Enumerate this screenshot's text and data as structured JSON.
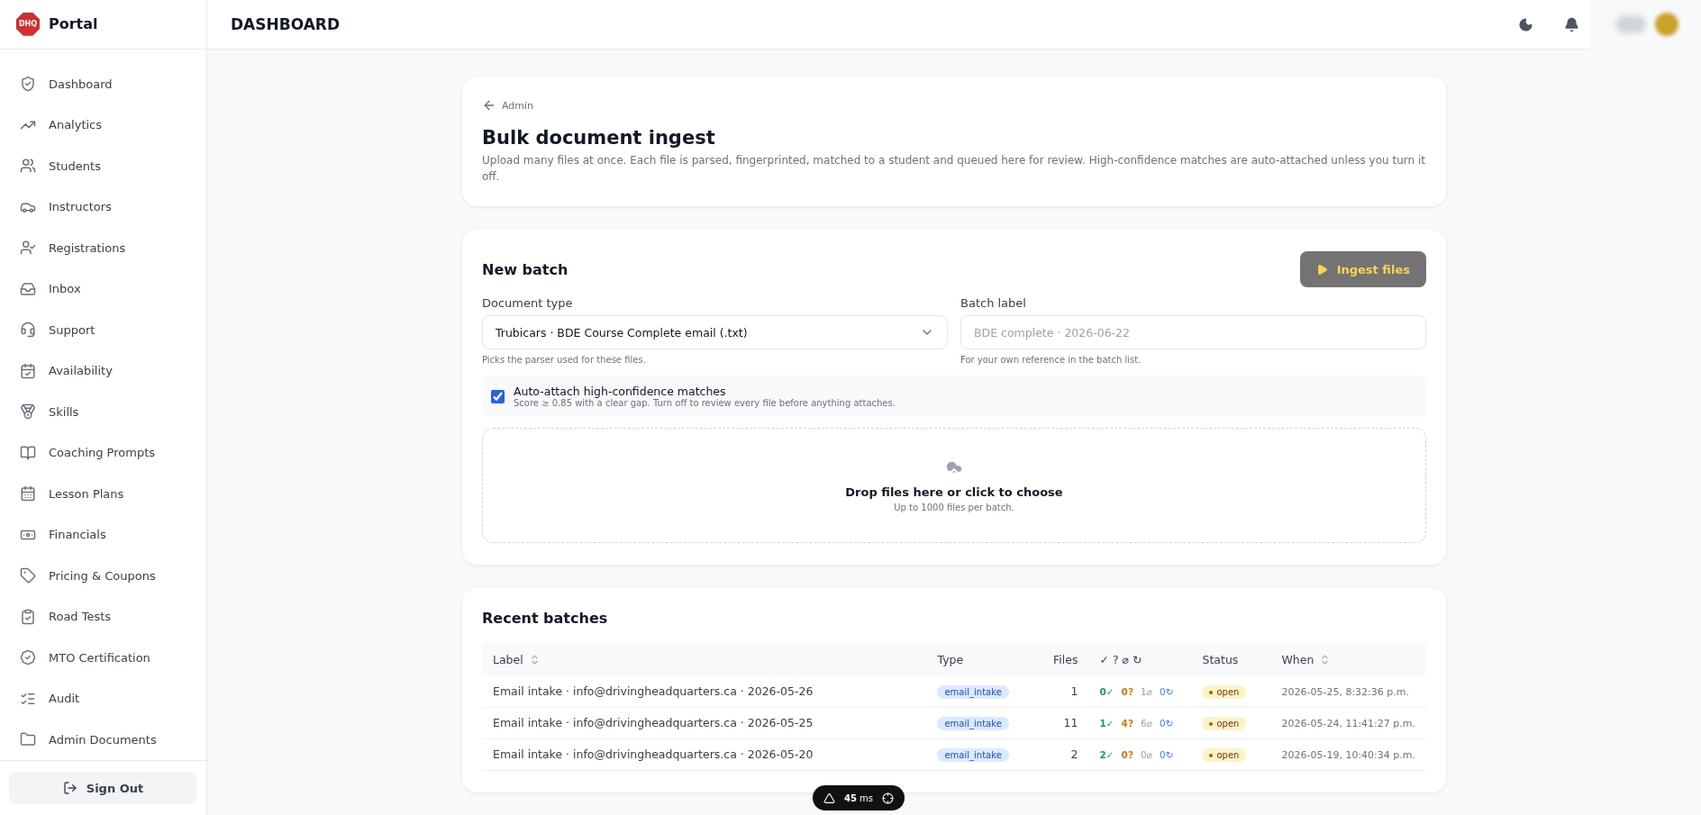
{
  "brand": {
    "logo": "DHQ",
    "name": "Portal"
  },
  "header": {
    "title": "DASHBOARD"
  },
  "sidebar": {
    "items": [
      {
        "label": "Dashboard"
      },
      {
        "label": "Analytics"
      },
      {
        "label": "Students"
      },
      {
        "label": "Instructors"
      },
      {
        "label": "Registrations"
      },
      {
        "label": "Inbox"
      },
      {
        "label": "Support"
      },
      {
        "label": "Availability"
      },
      {
        "label": "Skills"
      },
      {
        "label": "Coaching Prompts"
      },
      {
        "label": "Lesson Plans"
      },
      {
        "label": "Financials"
      },
      {
        "label": "Pricing & Coupons"
      },
      {
        "label": "Road Tests"
      },
      {
        "label": "MTO Certification"
      },
      {
        "label": "Audit"
      },
      {
        "label": "Admin Documents"
      }
    ],
    "sign_out": "Sign Out"
  },
  "intro": {
    "back": "Admin",
    "title": "Bulk document ingest",
    "description": "Upload many files at once. Each file is parsed, fingerprinted, matched to a student and queued here for review. High-confidence matches are auto-attached unless you turn it off."
  },
  "new_batch": {
    "title": "New batch",
    "button": "Ingest files",
    "document_type": {
      "label": "Document type",
      "value": "Trubicars · BDE Course Complete email (.txt)",
      "hint": "Picks the parser used for these files."
    },
    "batch_label": {
      "label": "Batch label",
      "placeholder": "BDE complete · 2026-06-22",
      "hint": "For your own reference in the batch list."
    },
    "auto_attach": {
      "label": "Auto-attach high-confidence matches",
      "hint": "Score ≥ 0.85 with a clear gap. Turn off to review every file before anything attaches.",
      "checked": true
    },
    "dropzone": {
      "title": "Drop files here or click to choose",
      "hint": "Up to 1000 files per batch."
    }
  },
  "recent": {
    "title": "Recent batches",
    "columns": [
      {
        "label": "Label",
        "sortable": true
      },
      {
        "label": "Type",
        "sortable": false
      },
      {
        "label": "Files",
        "sortable": false
      },
      {
        "label": "✓ ? ⌀ ↻",
        "sortable": false
      },
      {
        "label": "Status",
        "sortable": false
      },
      {
        "label": "When",
        "sortable": true
      }
    ],
    "rows": [
      {
        "label": "Email intake · info@drivingheadquarters.ca · 2026-05-26",
        "type": "email_intake",
        "files": "1",
        "stats": [
          {
            "kind": "matched",
            "text": "0✓"
          },
          {
            "kind": "unsure",
            "text": "0?"
          },
          {
            "kind": "skipped",
            "text": "1⌀"
          },
          {
            "kind": "retry",
            "text": "0↻"
          }
        ],
        "status": "open",
        "when": "2026-05-25, 8:32:36 p.m."
      },
      {
        "label": "Email intake · info@drivingheadquarters.ca · 2026-05-25",
        "type": "email_intake",
        "files": "11",
        "stats": [
          {
            "kind": "matched",
            "text": "1✓"
          },
          {
            "kind": "unsure",
            "text": "4?"
          },
          {
            "kind": "skipped",
            "text": "6⌀"
          },
          {
            "kind": "retry",
            "text": "0↻"
          }
        ],
        "status": "open",
        "when": "2026-05-24, 11:41:27 p.m."
      },
      {
        "label": "Email intake · info@drivingheadquarters.ca · 2026-05-20",
        "type": "email_intake",
        "files": "2",
        "stats": [
          {
            "kind": "matched",
            "text": "2✓"
          },
          {
            "kind": "unsure",
            "text": "0?"
          },
          {
            "kind": "skipped",
            "text": "0⌀"
          },
          {
            "kind": "retry",
            "text": "0↻"
          }
        ],
        "status": "open",
        "when": "2026-05-19, 10:40:34 p.m."
      }
    ]
  },
  "dev_toolbar": {
    "value": "45",
    "unit": "ms"
  }
}
